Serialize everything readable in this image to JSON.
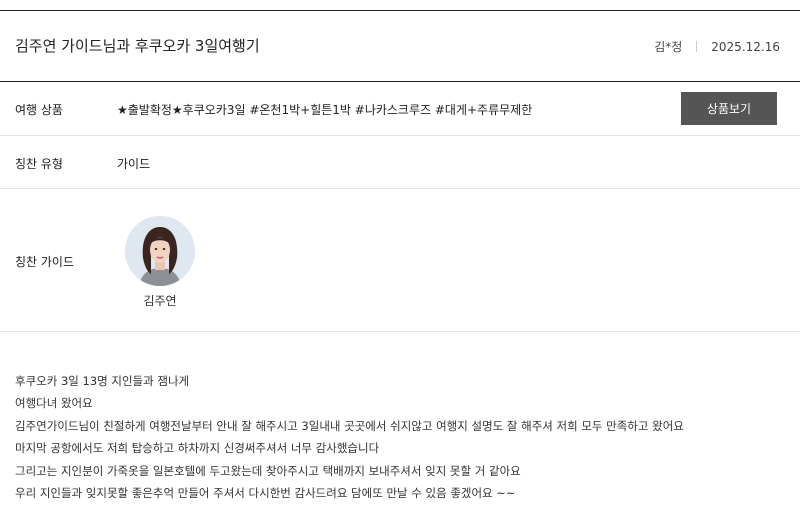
{
  "review": {
    "title": "김주연 가이드님과 후쿠오카 3일여행기",
    "author": "김*정",
    "date": "2025.12.16"
  },
  "product": {
    "label": "여행 상품",
    "value": "★출발확정★후쿠오카3일 #온천1박+힐튼1박 #나카스크루즈 #대게+주류무제한",
    "button_label": "상품보기"
  },
  "praise_type": {
    "label": "칭찬 유형",
    "value": "가이드"
  },
  "guide": {
    "label": "칭찬 가이드",
    "name": "김주연"
  },
  "content": {
    "lines": [
      "후쿠오카 3일 13명 지인들과 잼나게",
      "여행다녀 왔어요",
      "김주연가이드님이 친절하게 여행전날부터 안내 잘 해주시고 3일내내 곳곳에서 쉬지않고 여행지 설명도 잘 해주셔 저희 모두 만족하고 왔어요",
      "마지막 공항에서도 저희 탑승하고 하차까지 신경써주셔서 너무 감사했습니다",
      "그리고는 지인분이 가죽옷을 일본호텔에 두고왔는데 찾아주시고 택배까지 보내주셔서 잊지 못할 거 같아요",
      "우리 지인들과 잊지못할 좋은추억 만들어 주셔서 다시한번 감사드려요 담에또 만날 수 있음 좋겠어요 ~~"
    ]
  }
}
